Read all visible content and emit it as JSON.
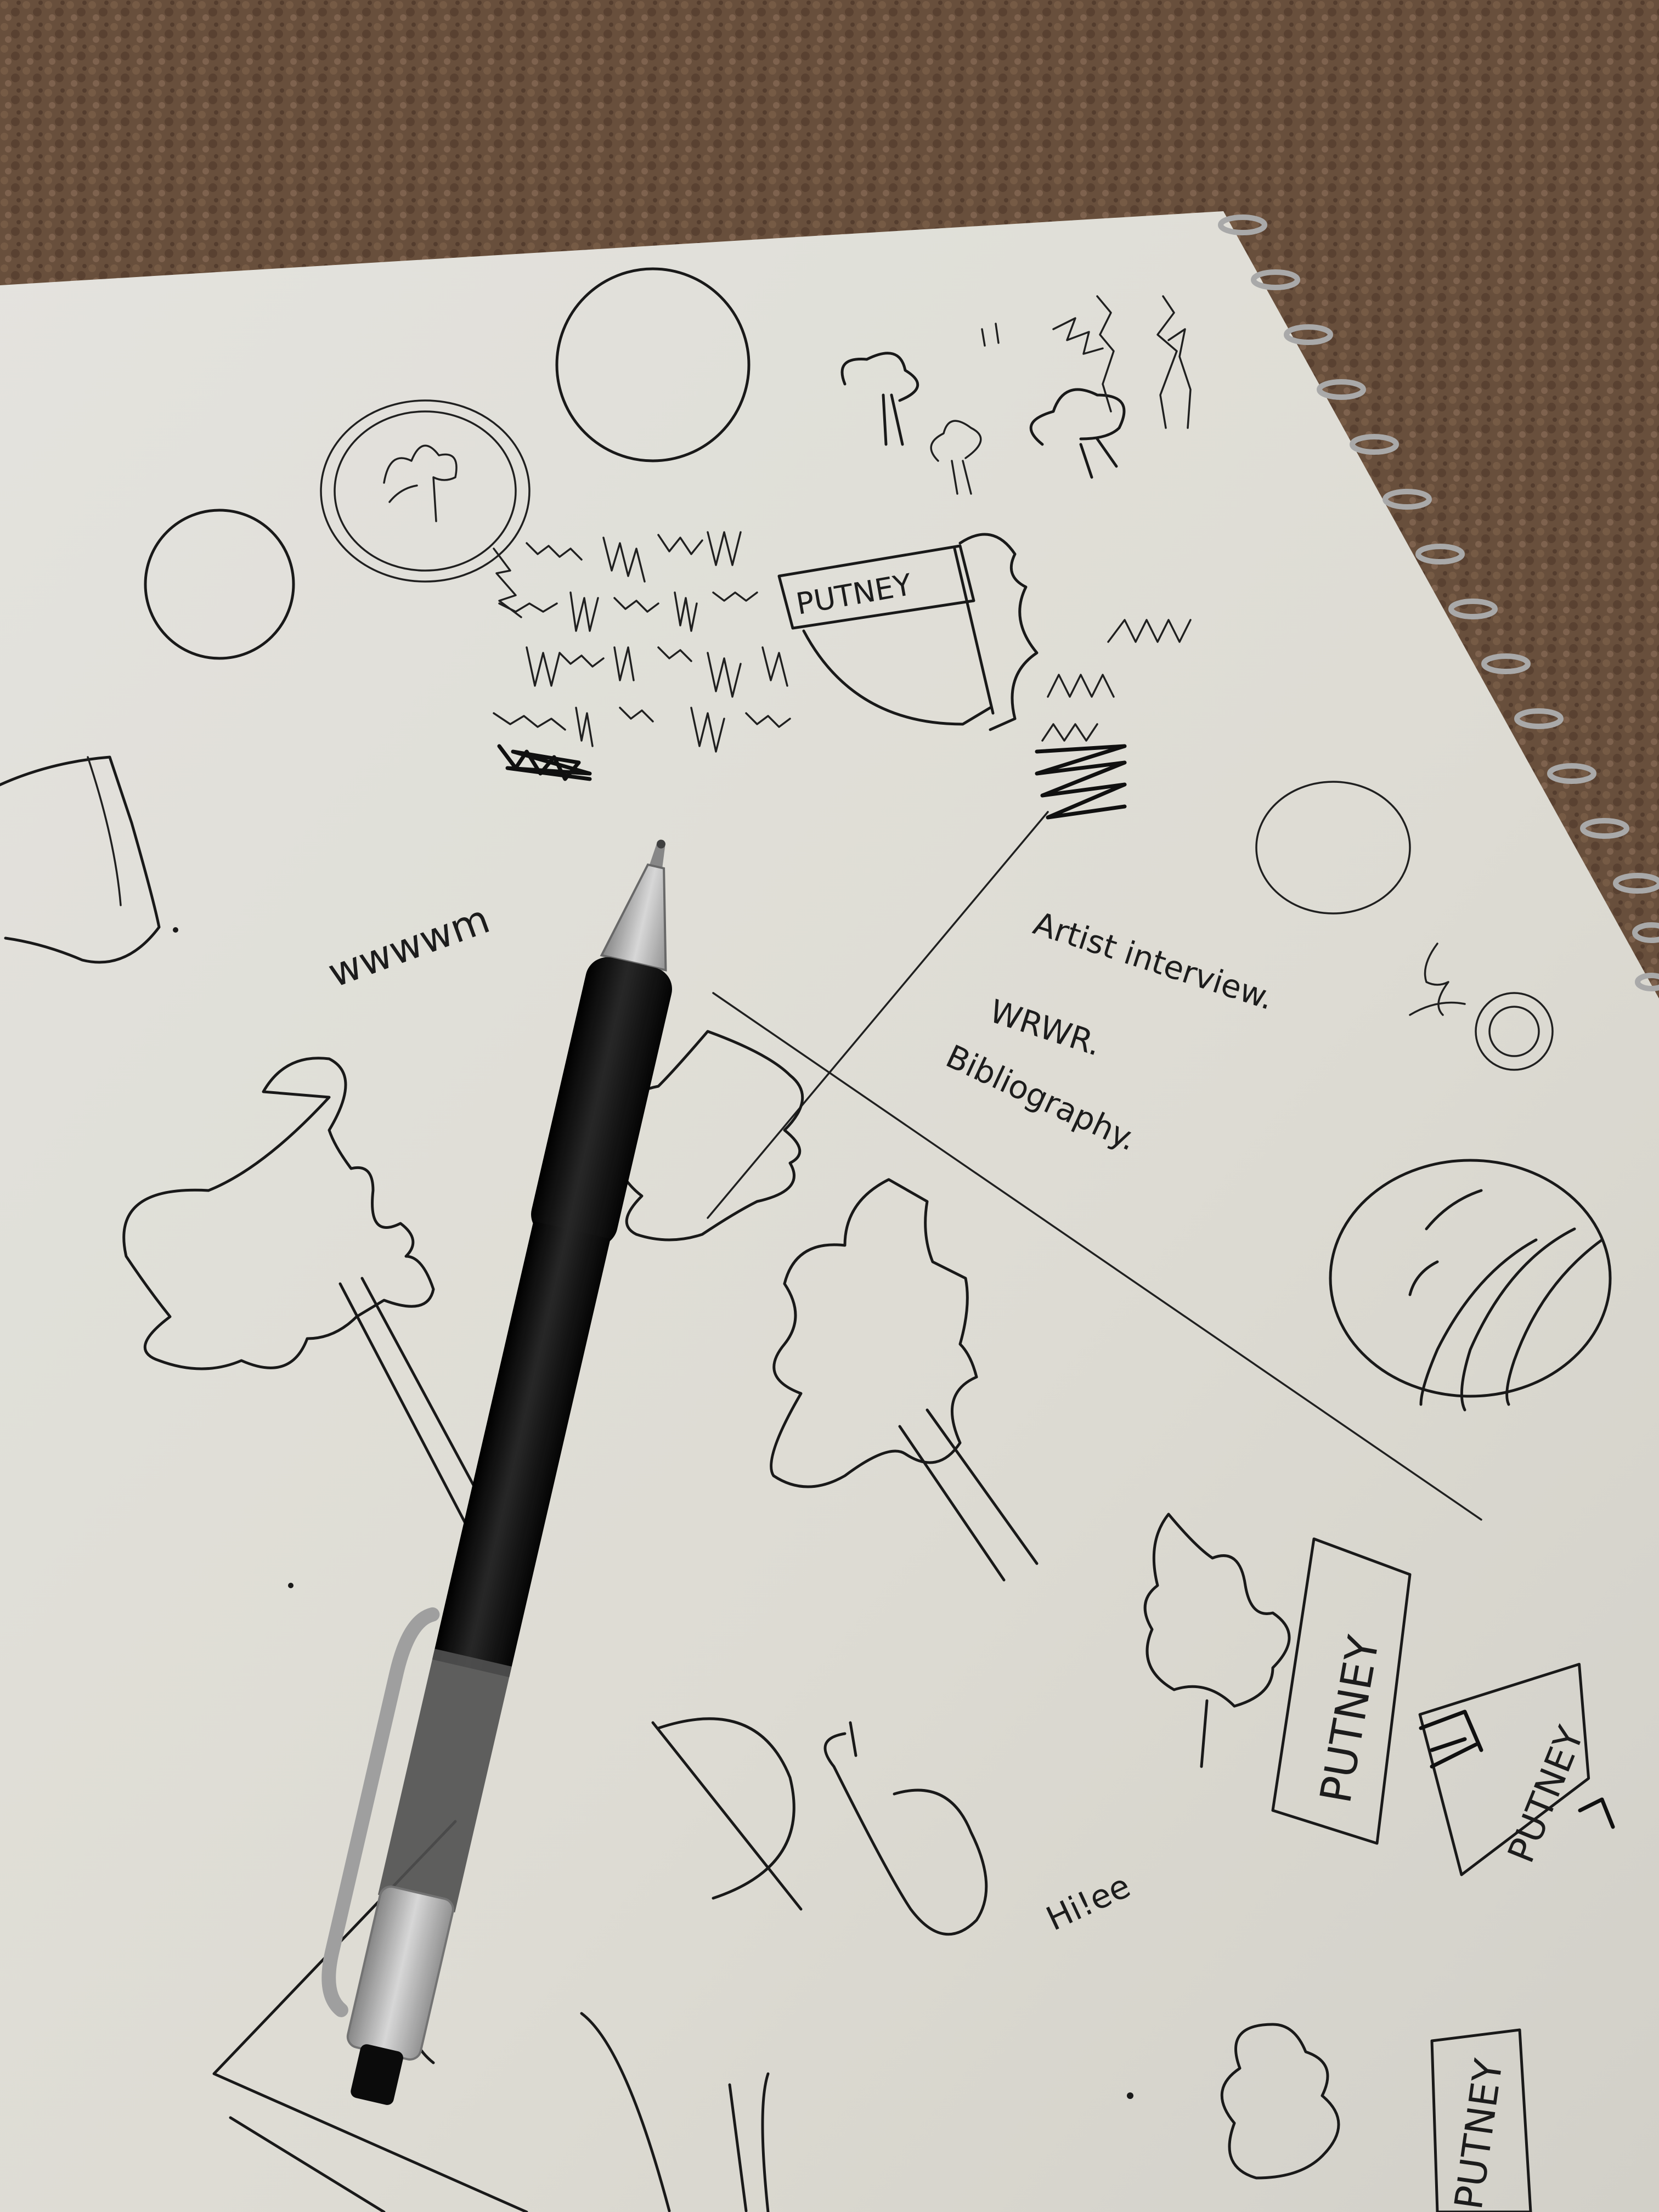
{
  "scene": {
    "colors": {
      "carpet": "#6e5440",
      "paper": "#eeede6",
      "ink": "#1b1b1b",
      "pen_barrel": "#141414",
      "pen_clear": "#c9c9c9",
      "spiral": "#b9b9b9"
    },
    "notes": {
      "line1": "Artist  interview.",
      "line2": "WRWR.",
      "line3": "Bibliography."
    },
    "signs": {
      "top": "PUTNEY",
      "middle_large": "PUTNEY",
      "middle_small": "PUTNEY",
      "bottom": "PUTNEY"
    },
    "scribbles": {
      "wavy": "wwwwm",
      "small": "Hi!ee"
    },
    "icons": [
      "spiral-binding-icon",
      "pen-icon",
      "tree-sketch-icon",
      "circle-sketch-icon",
      "signpost-sketch-icon",
      "hatch-pattern-icon"
    ]
  }
}
